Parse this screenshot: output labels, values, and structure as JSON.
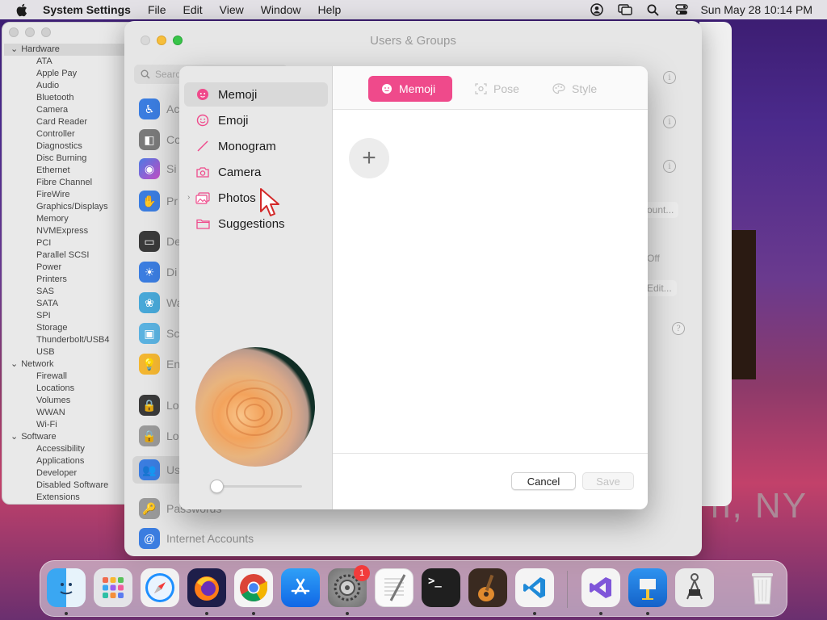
{
  "menubar": {
    "app_name": "System Settings",
    "menus": [
      "File",
      "Edit",
      "View",
      "Window",
      "Help"
    ],
    "clock": "Sun May 28  10:14 PM",
    "status_icons": [
      "user-account-icon",
      "screen-mirroring-icon",
      "spotlight-search-icon",
      "control-center-icon"
    ]
  },
  "system_information": {
    "categories": [
      {
        "label": "Hardware",
        "items": [
          "ATA",
          "Apple Pay",
          "Audio",
          "Bluetooth",
          "Camera",
          "Card Reader",
          "Controller",
          "Diagnostics",
          "Disc Burning",
          "Ethernet",
          "Fibre Channel",
          "FireWire",
          "Graphics/Displays",
          "Memory",
          "NVMExpress",
          "PCI",
          "Parallel SCSI",
          "Power",
          "Printers",
          "SAS",
          "SATA",
          "SPI",
          "Storage",
          "Thunderbolt/USB4",
          "USB"
        ]
      },
      {
        "label": "Network",
        "items": [
          "Firewall",
          "Locations",
          "Volumes",
          "WWAN",
          "Wi-Fi"
        ]
      },
      {
        "label": "Software",
        "items": [
          "Accessibility",
          "Applications",
          "Developer",
          "Disabled Software",
          "Extensions"
        ]
      }
    ]
  },
  "users_groups": {
    "title": "Users & Groups",
    "search_placeholder": "Search",
    "sidebar_partial": [
      "Ac",
      "Co",
      "Si",
      "Pr",
      "De",
      "Di",
      "Wa",
      "Sc",
      "En",
      "Lo",
      "Lo",
      "Us"
    ],
    "sidebar_full": [
      "Passwords",
      "Internet Accounts"
    ],
    "buttons": {
      "account": "ount...",
      "off": "Off",
      "edit": "Edit..."
    }
  },
  "sheet": {
    "sources": [
      {
        "label": "Memoji",
        "icon": "memoji-icon"
      },
      {
        "label": "Emoji",
        "icon": "emoji-icon"
      },
      {
        "label": "Monogram",
        "icon": "monogram-icon"
      },
      {
        "label": "Camera",
        "icon": "camera-icon"
      },
      {
        "label": "Photos",
        "icon": "photos-icon"
      },
      {
        "label": "Suggestions",
        "icon": "folder-icon"
      }
    ],
    "tabs": [
      {
        "label": "Memoji",
        "icon": "memoji-icon"
      },
      {
        "label": "Pose",
        "icon": "pose-icon"
      },
      {
        "label": "Style",
        "icon": "palette-icon"
      }
    ],
    "add_label": "+",
    "cancel_label": "Cancel",
    "save_label": "Save",
    "accent_color": "#ef4a8b"
  },
  "dock": {
    "badge_count": "1",
    "apps": [
      "Finder",
      "Launchpad",
      "Safari",
      "Firefox",
      "Google Chrome",
      "App Store",
      "System Settings",
      "TextEdit",
      "Terminal",
      "GarageBand",
      "Visual Studio Code",
      "Visual Studio",
      "Keynote",
      "Digital Color Meter",
      "Trash"
    ]
  },
  "desktop_text": "n, NY"
}
